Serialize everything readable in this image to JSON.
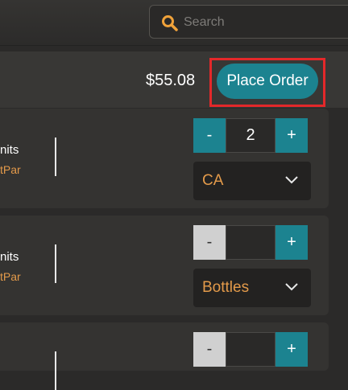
{
  "search": {
    "placeholder": "Search"
  },
  "order": {
    "total": "$55.08",
    "place_order_label": "Place Order"
  },
  "items": [
    {
      "name_line1": "nits",
      "name_line2": "tPar",
      "quantity": "2",
      "unit": "CA"
    },
    {
      "name_line1": "nits",
      "name_line2": "tPar",
      "quantity": "",
      "unit": "Bottles"
    },
    {
      "quantity": ""
    }
  ],
  "stepper": {
    "minus_label": "-",
    "plus_label": "+"
  },
  "colors": {
    "accent": "#1c8390",
    "highlight": "#e4282a",
    "orange_text": "#e39a4a"
  },
  "icons": {
    "search": "search-icon",
    "dropdown": "chevron-down-icon"
  }
}
